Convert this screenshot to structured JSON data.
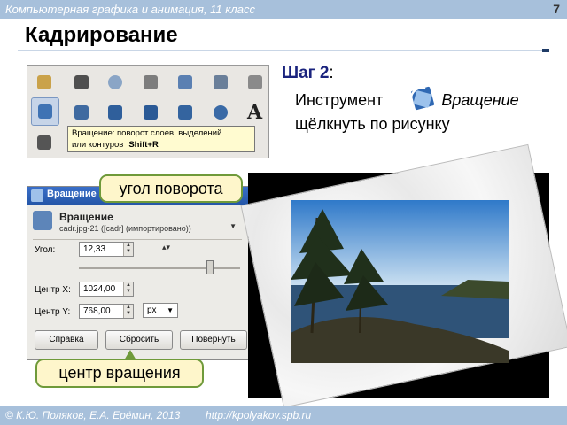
{
  "header": {
    "course": "Компьютерная графика и анимация, 11 класс",
    "page_number": "7"
  },
  "slide": {
    "title": "Кадрирование",
    "step_label": "Шаг 2",
    "step_colon": ":",
    "line1_prefix": "Инструмент",
    "line1_tool": "Вращение",
    "line2": "щёлкнуть по рисунку"
  },
  "toolbox": {
    "tooltip_text_1": "Вращение: поворот слоев, выделений",
    "tooltip_text_2": "или контуров",
    "tooltip_shortcut": "Shift+R",
    "colors": {
      "bg": "#e9e7e3",
      "selected": "#c6d4e8",
      "tooltip": "#fffbd0"
    }
  },
  "dialog": {
    "window_title": "Вращение",
    "heading": "Вращение",
    "subheading": "cadr.jpg-21 ([cadr] (импортировано))",
    "angle_label": "Угол:",
    "angle_value": "12,33",
    "center_x_label": "Центр X:",
    "center_x_value": "1024,00",
    "center_y_label": "Центр Y:",
    "center_y_value": "768,00",
    "unit": "px",
    "buttons": {
      "help": "Справка",
      "reset": "Сбросить",
      "rotate": "Повернуть"
    }
  },
  "callouts": {
    "angle": "угол поворота",
    "center": "центр вращения"
  },
  "footer": {
    "authors": "© К.Ю. Поляков, Е.А. Ерёмин, 2013",
    "url": "http://kpolyakov.spb.ru"
  },
  "colors": {
    "band": "#a7c0db",
    "callout_bg": "#fef6cb",
    "callout_border": "#6f9a3a",
    "step_label": "#1a237e"
  }
}
